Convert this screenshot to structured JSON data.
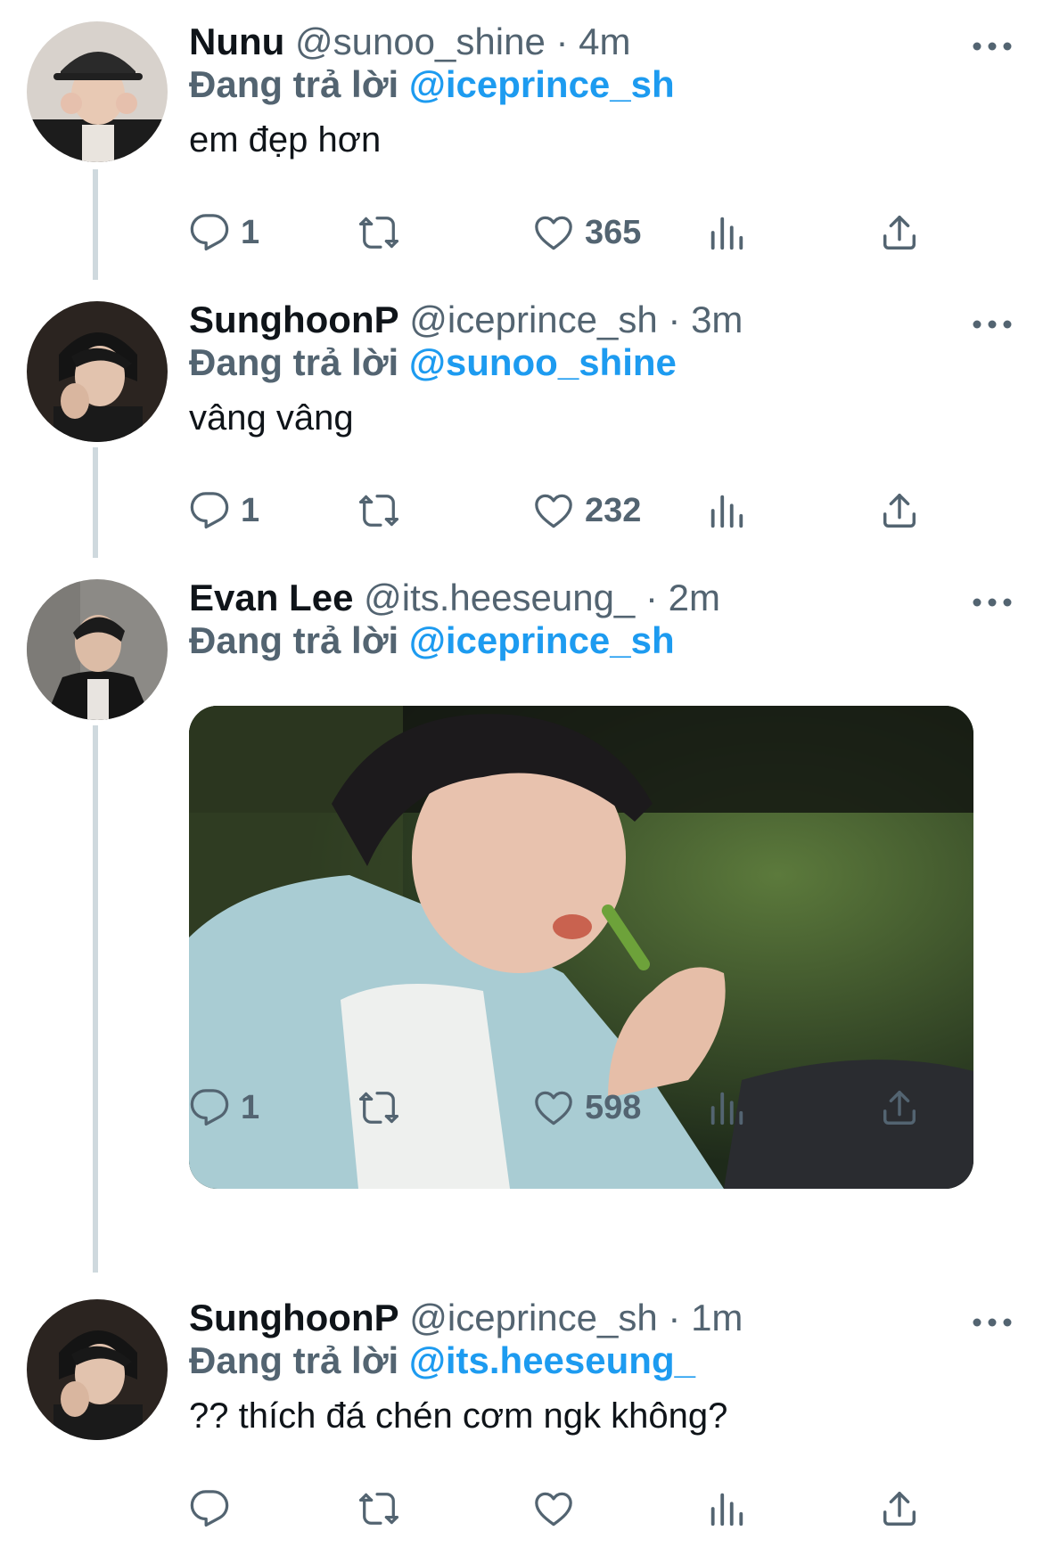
{
  "icons": {
    "reply": "reply-icon",
    "retweet": "retweet-icon",
    "like": "heart-icon",
    "views": "views-icon",
    "share": "share-icon",
    "more": "more-icon"
  },
  "colors": {
    "accent": "#1d9bf0",
    "muted": "#536471",
    "thread_line": "#cfd9de"
  },
  "tweets": [
    {
      "name": "Nunu",
      "handle": "@sunoo_shine",
      "dot": "·",
      "time": "4m",
      "reply_prefix": "Đang trả lời",
      "reply_to": "@iceprince_sh",
      "text": "em đẹp hơn",
      "replies": "1",
      "likes": "365"
    },
    {
      "name": "SunghoonP",
      "handle": "@iceprince_sh",
      "dot": "·",
      "time": "3m",
      "reply_prefix": "Đang trả lời",
      "reply_to": "@sunoo_shine",
      "text": "vâng vâng",
      "replies": "1",
      "likes": "232"
    },
    {
      "name": "Evan Lee",
      "handle": "@its.heeseung_",
      "dot": "·",
      "time": "2m",
      "reply_prefix": "Đang trả lời",
      "reply_to": "@iceprince_sh",
      "text": "",
      "replies": "1",
      "likes": "598"
    },
    {
      "name": "SunghoonP",
      "handle": "@iceprince_sh",
      "dot": "·",
      "time": "1m",
      "reply_prefix": "Đang trả lời",
      "reply_to": "@its.heeseung_",
      "text": "?? thích đá chén cơm ngk không?",
      "replies": "",
      "likes": ""
    }
  ]
}
